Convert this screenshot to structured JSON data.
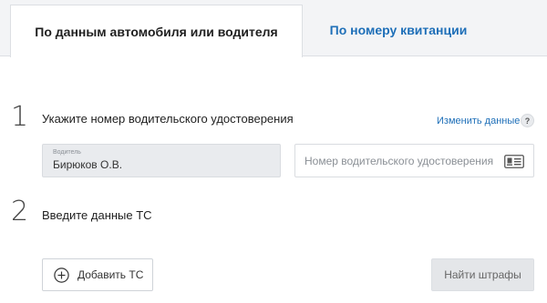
{
  "tabs": [
    {
      "label": "По данным автомобиля или водителя",
      "active": true
    },
    {
      "label": "По номеру квитанции",
      "active": false
    }
  ],
  "step1": {
    "number": "1",
    "title": "Укажите номер водительского удостоверения",
    "change_link": "Изменить данные",
    "help": "?",
    "driver": {
      "label": "Водитель",
      "value": "Бирюков О.В."
    },
    "license": {
      "placeholder": "Номер водительского удостоверения",
      "value": "",
      "icon": "id-card-icon"
    }
  },
  "step2": {
    "number": "2",
    "title": "Введите данные ТС",
    "add_button": "Добавить ТС"
  },
  "actions": {
    "find_button": "Найти штрафы"
  },
  "colors": {
    "link": "#1e6fb8",
    "tab_bg": "#f3f4f6",
    "disabled_button": "#e4e6e9"
  }
}
